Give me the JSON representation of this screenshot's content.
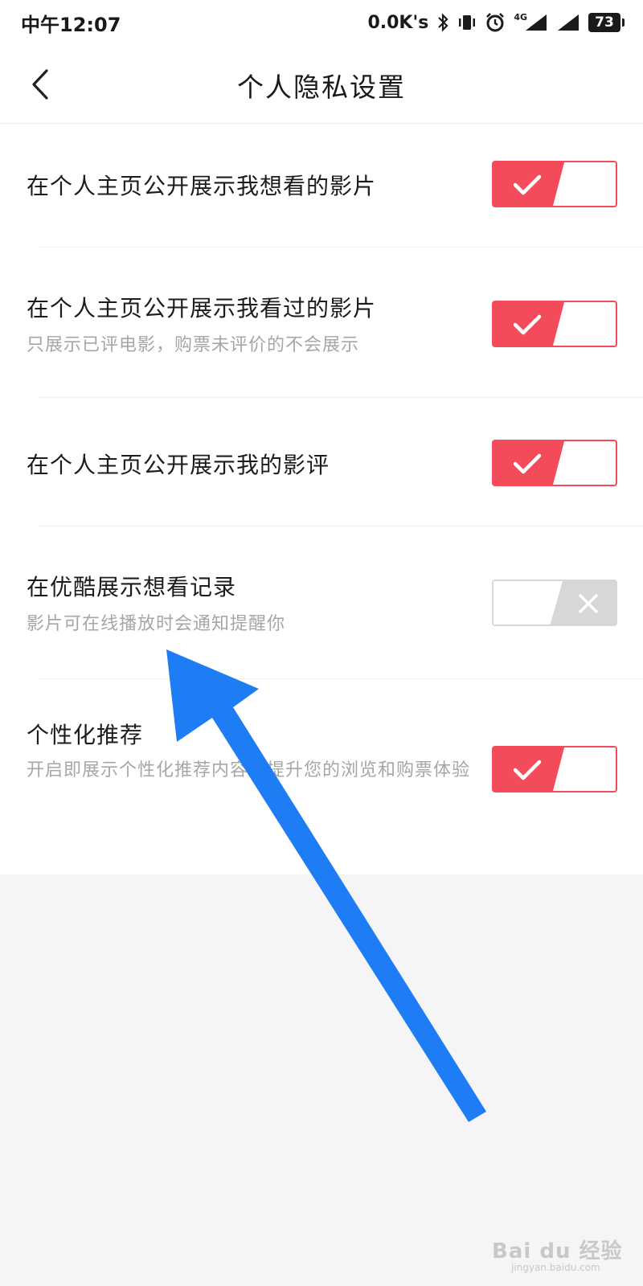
{
  "status_bar": {
    "time": "中午12:07",
    "network_speed": "0.0K's",
    "network_type": "4G",
    "battery": "73",
    "icons": [
      "bluetooth-icon",
      "vibrate-icon",
      "alarm-icon",
      "signal-icon",
      "signal-icon",
      "battery-icon"
    ]
  },
  "nav": {
    "back_icon": "chevron-left-icon",
    "title": "个人隐私设置"
  },
  "settings": [
    {
      "title": "在个人主页公开展示我想看的影片",
      "subtitle": "",
      "enabled": true
    },
    {
      "title": "在个人主页公开展示我看过的影片",
      "subtitle": "只展示已评电影，购票未评价的不会展示",
      "enabled": true
    },
    {
      "title": "在个人主页公开展示我的影评",
      "subtitle": "",
      "enabled": true
    },
    {
      "title": "在优酷展示想看记录",
      "subtitle": "影片可在线播放时会通知提醒你",
      "enabled": false
    },
    {
      "title": "个性化推荐",
      "subtitle": "开启即展示个性化推荐内容，提升您的浏览和购票体验",
      "enabled": true
    }
  ],
  "annotation": {
    "icon": "arrow-icon",
    "color": "#1e7cf5"
  },
  "watermark": {
    "text": "Bai du 经验",
    "url": "jingyan.baidu.com"
  },
  "colors": {
    "toggle_on": "#f34b5a",
    "toggle_off": "#d7d7d7"
  }
}
